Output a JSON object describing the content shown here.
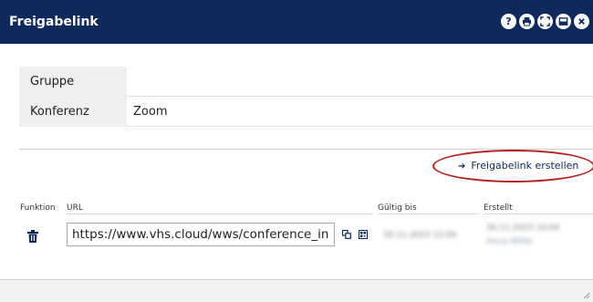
{
  "window": {
    "title": "Freigabelink",
    "icons": [
      "help-icon",
      "print-icon",
      "fullscreen-icon",
      "minimize-icon",
      "close-icon"
    ]
  },
  "info": {
    "rows": [
      {
        "label": "Gruppe",
        "value": ""
      },
      {
        "label": "Konferenz",
        "value": "Zoom"
      }
    ]
  },
  "actions": {
    "create_link_label": "Freigabelink erstellen"
  },
  "table": {
    "columns": {
      "function": "Funktion",
      "url": "URL",
      "valid_until": "Gültig bis",
      "created": "Erstellt"
    },
    "rows": [
      {
        "url": "https://www.vhs.cloud/wws/conference_invite",
        "valid_until": "30.11.2023 12:04",
        "created_date": "30.11.2023 10:04",
        "created_by": "Anna Wilde"
      }
    ]
  },
  "colors": {
    "titlebar": "#0e2a5c",
    "highlight": "#b3201e"
  }
}
